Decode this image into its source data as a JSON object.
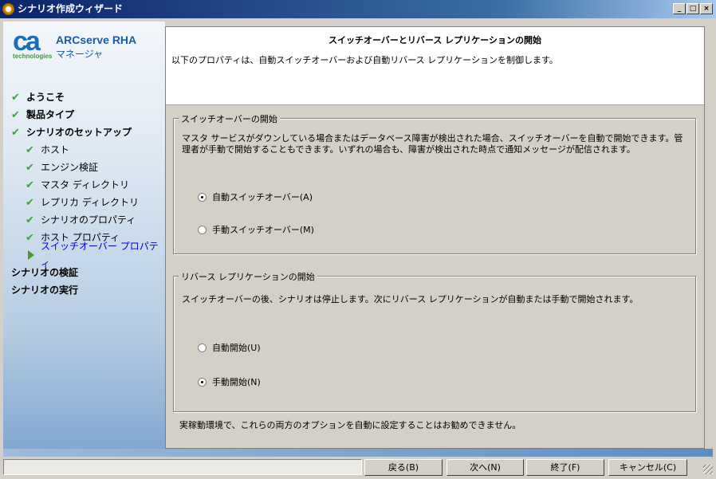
{
  "window": {
    "title": "シナリオ作成ウィザード",
    "controls": [
      "_",
      "□",
      "×"
    ]
  },
  "sidebar": {
    "logo": {
      "mark": "ca",
      "sub": "technologies"
    },
    "product_name": "ARCserve RHA",
    "product_sub": "マネージャ",
    "items": [
      {
        "label": "ようこそ",
        "level": "top",
        "state": "done"
      },
      {
        "label": "製品タイプ",
        "level": "top",
        "state": "done"
      },
      {
        "label": "シナリオのセットアップ",
        "level": "top",
        "state": "done"
      },
      {
        "label": "ホスト",
        "level": "sub",
        "state": "done"
      },
      {
        "label": "エンジン検証",
        "level": "sub",
        "state": "done"
      },
      {
        "label": "マスタ ディレクトリ",
        "level": "sub",
        "state": "done"
      },
      {
        "label": "レプリカ ディレクトリ",
        "level": "sub",
        "state": "done"
      },
      {
        "label": "シナリオのプロパティ",
        "level": "sub",
        "state": "done"
      },
      {
        "label": "ホスト プロパティ",
        "level": "sub",
        "state": "done"
      },
      {
        "label": "スイッチオーバー プロパティ",
        "level": "sub",
        "state": "current"
      },
      {
        "label": "シナリオの検証",
        "level": "top",
        "state": "pending"
      },
      {
        "label": "シナリオの実行",
        "level": "top",
        "state": "pending"
      }
    ]
  },
  "header": {
    "title": "スイッチオーバーとリバース レプリケーションの開始",
    "description": "以下のプロパティは、自動スイッチオーバーおよび自動リバース レプリケーションを制御します。"
  },
  "switchover": {
    "label": "スイッチオーバーの開始",
    "description": "マスタ サービスがダウンしている場合またはデータベース障害が検出された場合、スイッチオーバーを自動で開始できます。管理者が手動で開始することもできます。いずれの場合も、障害が検出された時点で通知メッセージが配信されます。",
    "options": [
      {
        "label": "自動スイッチオーバー(A)",
        "selected": true
      },
      {
        "label": "手動スイッチオーバー(M)",
        "selected": false
      }
    ]
  },
  "reverse": {
    "label": "リバース レプリケーションの開始",
    "description": "スイッチオーバーの後、シナリオは停止します。次にリバース レプリケーションが自動または手動で開始されます。",
    "options": [
      {
        "label": "自動開始(U)",
        "selected": false
      },
      {
        "label": "手動開始(N)",
        "selected": true
      }
    ]
  },
  "note": "実稼動環境で、これらの両方のオプションを自動に設定することはお勧めできません。",
  "buttons": {
    "back": "戻る(B)",
    "next": "次へ(N)",
    "finish": "終了(F)",
    "cancel": "キャンセル(C)"
  },
  "status_text": "",
  "colors": {
    "accent": "#1c5aa6",
    "current_step": "#0000e0",
    "check": "#3aa53a"
  }
}
